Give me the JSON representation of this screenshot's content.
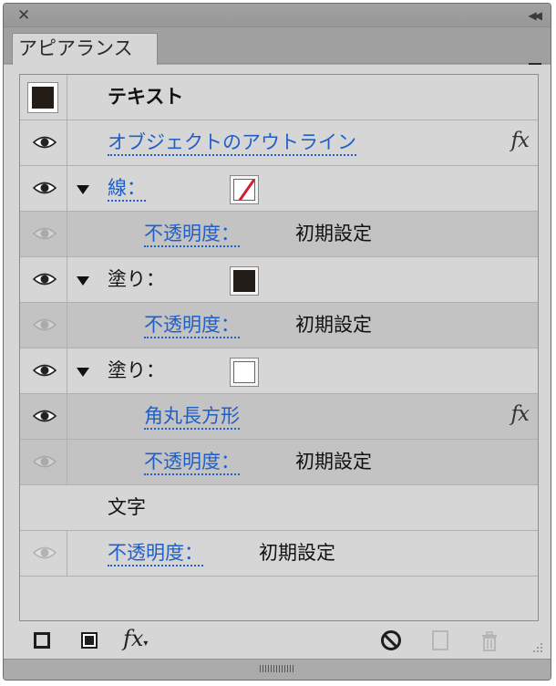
{
  "panel": {
    "close_glyph": "✕",
    "collapse_glyph": "◀◀",
    "tab_label": "アピアランス"
  },
  "rows": [
    {
      "type": "header",
      "label": "テキスト"
    },
    {
      "type": "effect",
      "label": "オブジェクトのアウトライン",
      "fx": "fx"
    },
    {
      "type": "stroke",
      "label": "線：",
      "swatch": "none"
    },
    {
      "type": "opacity",
      "label": "不透明度：",
      "value": "初期設定"
    },
    {
      "type": "fill",
      "label": "塗り：",
      "swatch": "black"
    },
    {
      "type": "opacity",
      "label": "不透明度：",
      "value": "初期設定"
    },
    {
      "type": "fill",
      "label": "塗り：",
      "swatch": "white"
    },
    {
      "type": "effect",
      "label": "角丸長方形",
      "fx": "fx"
    },
    {
      "type": "opacity",
      "label": "不透明度：",
      "value": "初期設定"
    },
    {
      "type": "characters",
      "label": "文字"
    },
    {
      "type": "opacity",
      "label": "不透明度：",
      "value": "初期設定"
    }
  ],
  "bottom": {
    "fx_label": "fx",
    "fx_arrow": "▾"
  },
  "colors": {
    "link": "#1f5fc7",
    "dark_swatch": "#231d1a",
    "none_slash": "#d21f2f"
  }
}
